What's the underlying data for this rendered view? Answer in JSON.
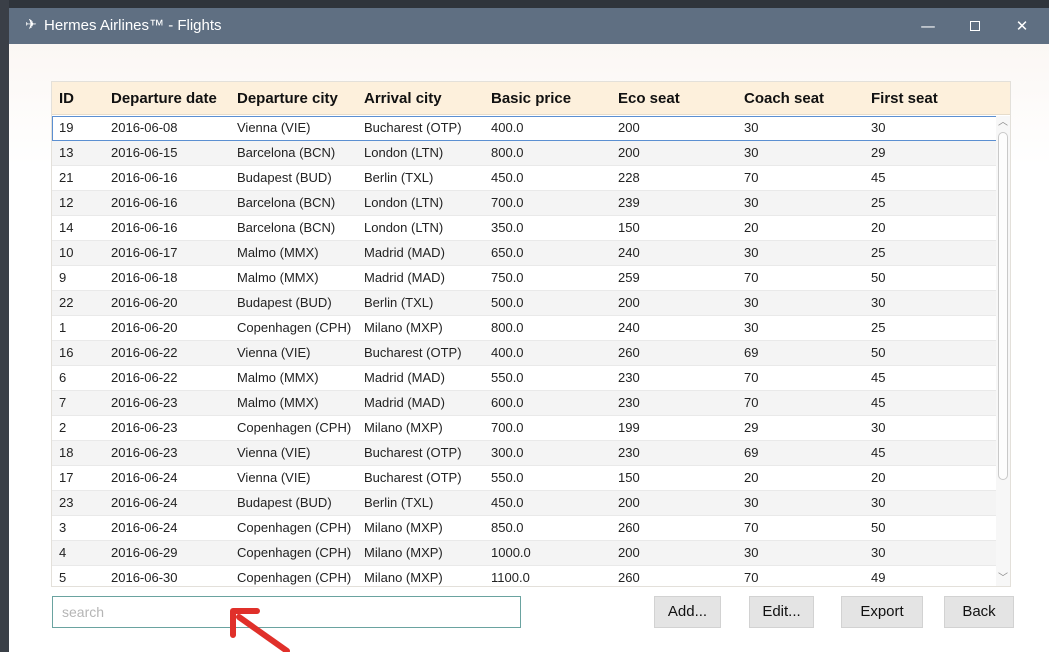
{
  "window": {
    "app_icon": "airplane-icon",
    "title": "Hermes Airlines™  -  Flights",
    "controls": {
      "minimize": "—",
      "close": "✕"
    }
  },
  "table": {
    "columns": [
      "ID",
      "Departure date",
      "Departure city",
      "Arrival city",
      "Basic price",
      "Eco seat",
      "Coach seat",
      "First seat"
    ],
    "rows": [
      [
        "19",
        "2016-06-08",
        "Vienna (VIE)",
        "Bucharest (OTP)",
        "400.0",
        "200",
        "30",
        "30"
      ],
      [
        "13",
        "2016-06-15",
        "Barcelona (BCN)",
        "London (LTN)",
        "800.0",
        "200",
        "30",
        "29"
      ],
      [
        "21",
        "2016-06-16",
        "Budapest (BUD)",
        "Berlin (TXL)",
        "450.0",
        "228",
        "70",
        "45"
      ],
      [
        "12",
        "2016-06-16",
        "Barcelona (BCN)",
        "London (LTN)",
        "700.0",
        "239",
        "30",
        "25"
      ],
      [
        "14",
        "2016-06-16",
        "Barcelona (BCN)",
        "London (LTN)",
        "350.0",
        "150",
        "20",
        "20"
      ],
      [
        "10",
        "2016-06-17",
        "Malmo (MMX)",
        "Madrid (MAD)",
        "650.0",
        "240",
        "30",
        "25"
      ],
      [
        "9",
        "2016-06-18",
        "Malmo (MMX)",
        "Madrid (MAD)",
        "750.0",
        "259",
        "70",
        "50"
      ],
      [
        "22",
        "2016-06-20",
        "Budapest (BUD)",
        "Berlin (TXL)",
        "500.0",
        "200",
        "30",
        "30"
      ],
      [
        "1",
        "2016-06-20",
        "Copenhagen (CPH)",
        "Milano (MXP)",
        "800.0",
        "240",
        "30",
        "25"
      ],
      [
        "16",
        "2016-06-22",
        "Vienna (VIE)",
        "Bucharest (OTP)",
        "400.0",
        "260",
        "69",
        "50"
      ],
      [
        "6",
        "2016-06-22",
        "Malmo (MMX)",
        "Madrid (MAD)",
        "550.0",
        "230",
        "70",
        "45"
      ],
      [
        "7",
        "2016-06-23",
        "Malmo (MMX)",
        "Madrid (MAD)",
        "600.0",
        "230",
        "70",
        "45"
      ],
      [
        "2",
        "2016-06-23",
        "Copenhagen (CPH)",
        "Milano (MXP)",
        "700.0",
        "199",
        "29",
        "30"
      ],
      [
        "18",
        "2016-06-23",
        "Vienna (VIE)",
        "Bucharest (OTP)",
        "300.0",
        "230",
        "69",
        "45"
      ],
      [
        "17",
        "2016-06-24",
        "Vienna (VIE)",
        "Bucharest (OTP)",
        "550.0",
        "150",
        "20",
        "20"
      ],
      [
        "23",
        "2016-06-24",
        "Budapest (BUD)",
        "Berlin (TXL)",
        "450.0",
        "200",
        "30",
        "30"
      ],
      [
        "3",
        "2016-06-24",
        "Copenhagen (CPH)",
        "Milano (MXP)",
        "850.0",
        "260",
        "70",
        "50"
      ],
      [
        "4",
        "2016-06-29",
        "Copenhagen (CPH)",
        "Milano (MXP)",
        "1000.0",
        "200",
        "30",
        "30"
      ],
      [
        "5",
        "2016-06-30",
        "Copenhagen (CPH)",
        "Milano (MXP)",
        "1100.0",
        "260",
        "70",
        "49"
      ]
    ],
    "selected_row_index": 0
  },
  "search": {
    "placeholder": "search",
    "value": ""
  },
  "buttons": {
    "add": "Add...",
    "edit": "Edit...",
    "export": "Export",
    "back": "Back"
  },
  "colors": {
    "titlebar": "#5f6f82",
    "header_bg": "#fdf0dc",
    "selection_border": "#5b8fd1",
    "search_border": "#6aa3a0",
    "annotation_arrow": "#e0302a"
  }
}
